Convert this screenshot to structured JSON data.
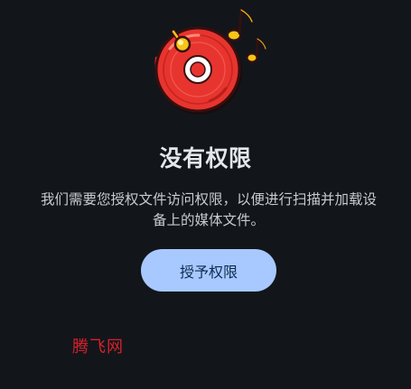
{
  "permission_screen": {
    "title": "没有权限",
    "description": "我们需要您授权文件访问权限，以便进行扫描并加载设备上的媒体文件。",
    "grant_button_label": "授予权限"
  },
  "watermark": {
    "text": "腾飞网"
  },
  "colors": {
    "background": "#12161b",
    "title": "#e3e6ea",
    "description": "#c7cbd0",
    "button_background": "#a8c9ff",
    "button_text": "#0f2a52",
    "record_red": "#e8342f",
    "note_yellow": "#f5c518",
    "watermark": "#d6212b"
  },
  "icons": {
    "illustration": "music-record-icon",
    "notes": "music-note-icon"
  }
}
